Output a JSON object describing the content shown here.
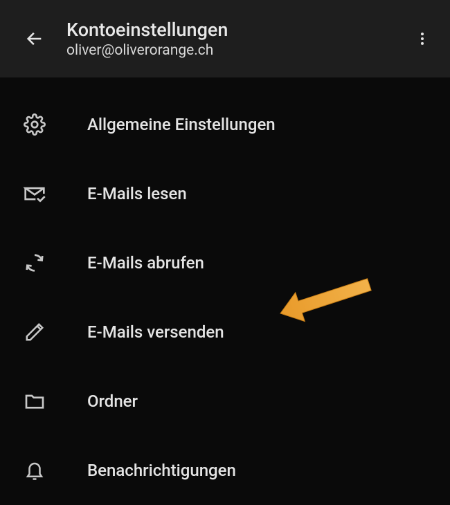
{
  "header": {
    "title": "Kontoeinstellungen",
    "subtitle": "oliver@oliverorange.ch"
  },
  "menu": {
    "items": [
      {
        "label": "Allgemeine Einstellungen"
      },
      {
        "label": "E-Mails lesen"
      },
      {
        "label": "E-Mails abrufen"
      },
      {
        "label": "E-Mails versenden"
      },
      {
        "label": "Ordner"
      },
      {
        "label": "Benachrichtigungen"
      }
    ]
  },
  "annotation": {
    "target_index": 3,
    "color": "#e89a2a"
  }
}
